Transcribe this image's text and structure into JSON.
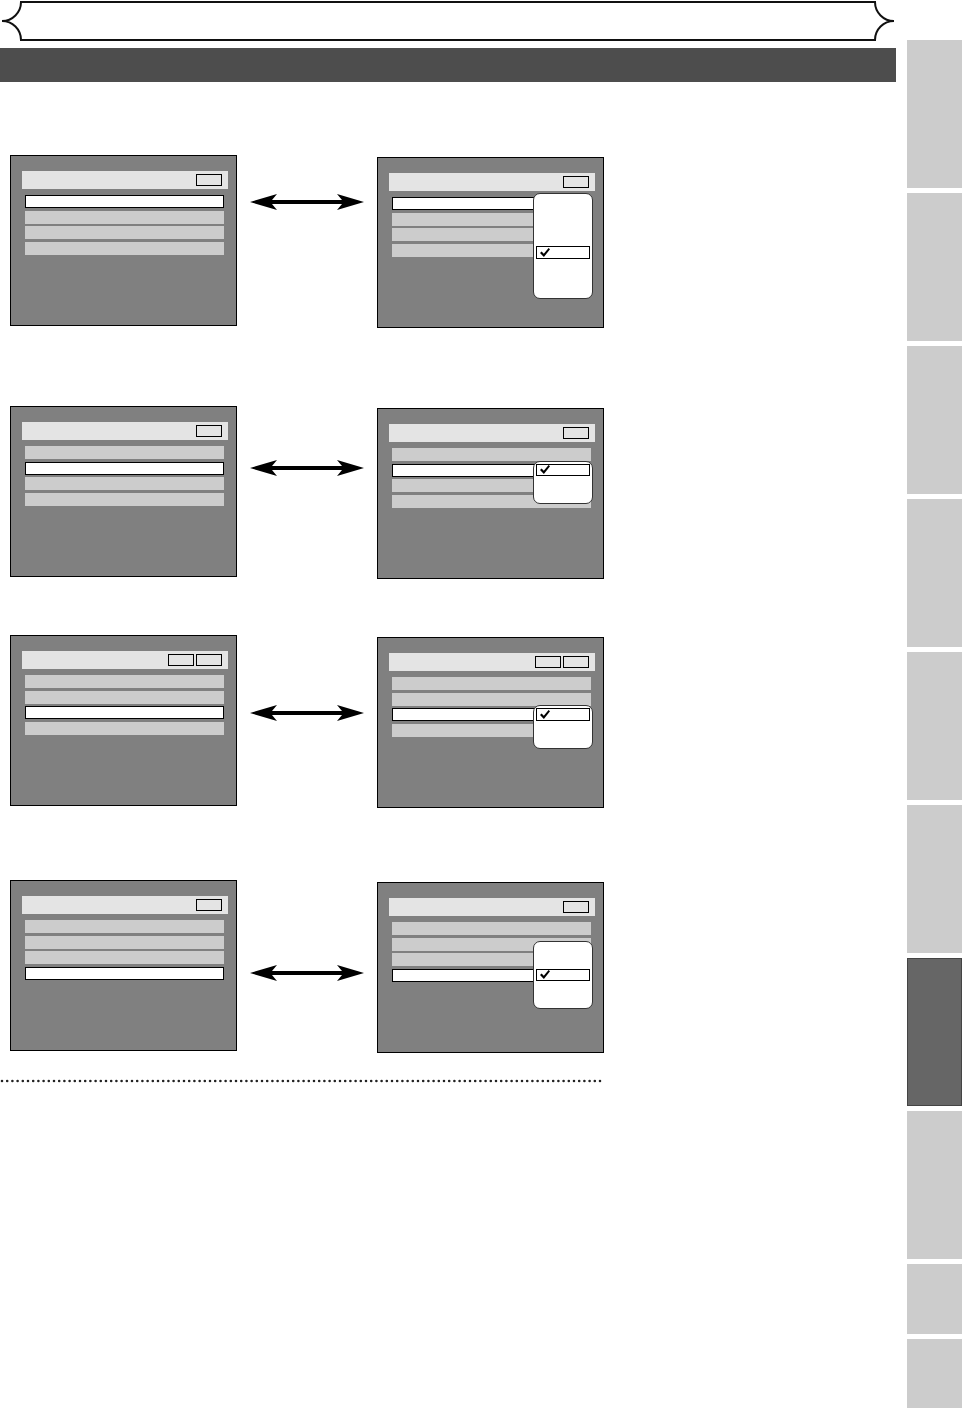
{
  "side_tabs": [
    {
      "selected": false
    },
    {
      "selected": false
    },
    {
      "selected": false
    },
    {
      "selected": false
    },
    {
      "selected": false
    },
    {
      "selected": false
    },
    {
      "selected": true
    },
    {
      "selected": false
    },
    {
      "selected": false
    },
    {
      "selected": false
    }
  ],
  "figures": [
    {
      "before": {
        "header_boxes": [
          {
            "kind": "blank"
          }
        ],
        "rows": [
          {
            "selected": true
          },
          {
            "selected": false
          },
          {
            "selected": false
          },
          {
            "selected": false
          }
        ]
      },
      "after": {
        "header_boxes": [
          {
            "kind": "blank"
          }
        ],
        "rows": [
          {
            "selected": true
          },
          {
            "selected": false
          },
          {
            "selected": false
          },
          {
            "selected": false
          }
        ],
        "popup": {
          "options": [
            {
              "kind": "empty"
            },
            {
              "kind": "empty"
            },
            {
              "kind": "empty"
            },
            {
              "kind": "empty"
            },
            {
              "kind": "ticked"
            },
            {
              "kind": "empty"
            },
            {
              "kind": "empty"
            },
            {
              "kind": "empty"
            }
          ]
        }
      }
    },
    {
      "before": {
        "header_boxes": [
          {
            "kind": "blank"
          }
        ],
        "rows": [
          {
            "selected": false
          },
          {
            "selected": true
          },
          {
            "selected": false
          },
          {
            "selected": false
          }
        ]
      },
      "after": {
        "header_boxes": [
          {
            "kind": "blank"
          }
        ],
        "rows": [
          {
            "selected": false
          },
          {
            "selected": true
          },
          {
            "selected": false
          },
          {
            "selected": false
          }
        ],
        "popup": {
          "options": [
            {
              "kind": "ticked"
            },
            {
              "kind": "empty"
            },
            {
              "kind": "empty"
            }
          ]
        }
      }
    },
    {
      "before": {
        "header_boxes": [
          {
            "kind": "blank"
          },
          {
            "kind": "blank"
          }
        ],
        "rows": [
          {
            "selected": false
          },
          {
            "selected": false
          },
          {
            "selected": true
          },
          {
            "selected": false
          }
        ]
      },
      "after": {
        "header_boxes": [
          {
            "kind": "blank"
          },
          {
            "kind": "blank"
          }
        ],
        "rows": [
          {
            "selected": false
          },
          {
            "selected": false
          },
          {
            "selected": true
          },
          {
            "selected": false
          }
        ],
        "popup": {
          "options": [
            {
              "kind": "ticked"
            },
            {
              "kind": "empty"
            },
            {
              "kind": "empty"
            }
          ]
        }
      }
    },
    {
      "before": {
        "header_boxes": [
          {
            "kind": "blank"
          }
        ],
        "rows": [
          {
            "selected": false
          },
          {
            "selected": false
          },
          {
            "selected": false
          },
          {
            "selected": true
          }
        ]
      },
      "after": {
        "header_boxes": [
          {
            "kind": "blank"
          }
        ],
        "rows": [
          {
            "selected": false
          },
          {
            "selected": false
          },
          {
            "selected": false
          },
          {
            "selected": true
          }
        ],
        "popup": {
          "options": [
            {
              "kind": "empty"
            },
            {
              "kind": "empty"
            },
            {
              "kind": "ticked"
            },
            {
              "kind": "empty"
            },
            {
              "kind": "empty"
            }
          ]
        }
      }
    }
  ]
}
